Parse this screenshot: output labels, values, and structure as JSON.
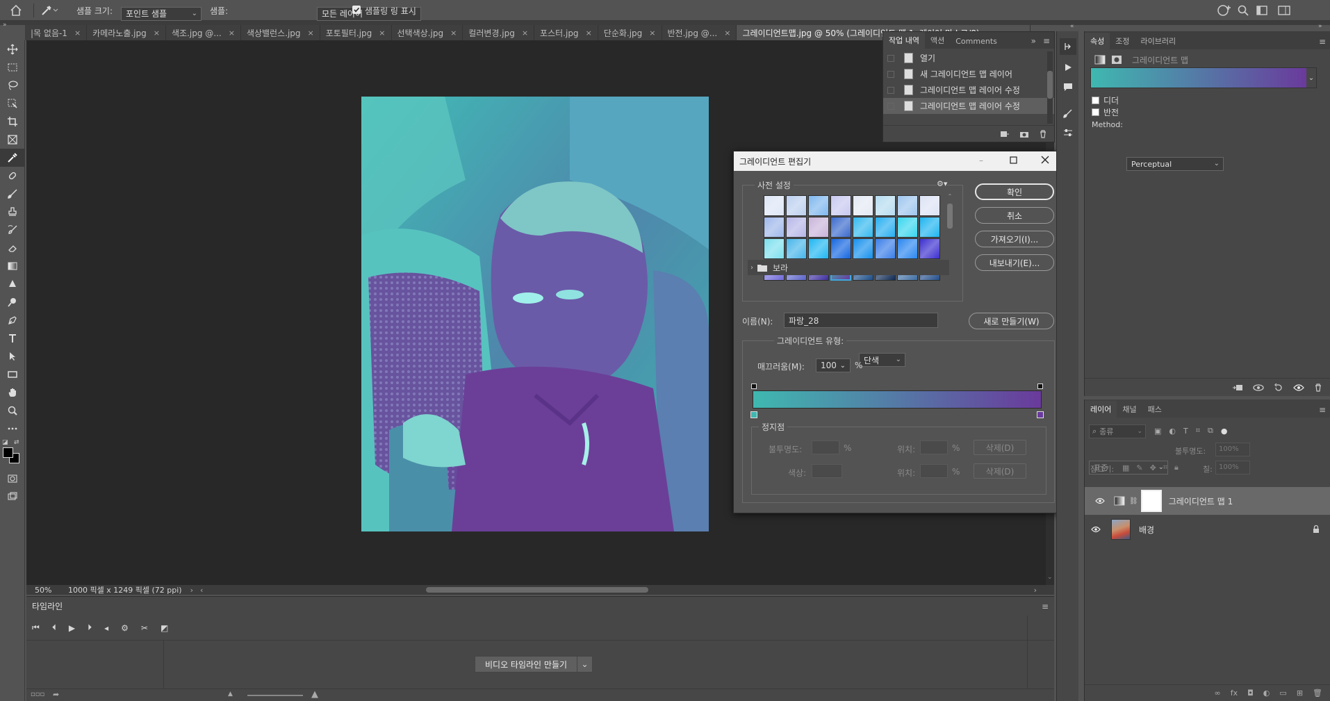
{
  "options_bar": {
    "sample_size_label": "샘플 크기:",
    "sample_size_value": "포인트 샘플",
    "sample_label": "샘플:",
    "sample_value": "모든 레이어",
    "show_ring_label": "샘플링 링 표시",
    "show_ring_checked": true
  },
  "tabs": [
    {
      "label": "|목 없음-1",
      "active": false
    },
    {
      "label": "카메라노출.jpg",
      "active": false
    },
    {
      "label": "색조.jpg @...",
      "active": false
    },
    {
      "label": "색상밸런스.jpg",
      "active": false
    },
    {
      "label": "포토필터.jpg",
      "active": false
    },
    {
      "label": "선택색상.jpg",
      "active": false
    },
    {
      "label": "컬러변경.jpg",
      "active": false
    },
    {
      "label": "포스터.jpg",
      "active": false
    },
    {
      "label": "단순화.jpg",
      "active": false
    },
    {
      "label": "반전.jpg @...",
      "active": false
    },
    {
      "label": "그레이디언트맵.jpg @ 50% (그레이디언트 맵 1, 레이어 마스크/8)",
      "active": true
    }
  ],
  "status_bar": {
    "zoom": "50%",
    "doc_info": "1000 픽셀 x 1249 픽셀 (72 ppi)"
  },
  "timeline": {
    "title": "타임라인",
    "create_button": "비디오 타임라인 만들기"
  },
  "history_panel": {
    "tabs": [
      "작업 내역",
      "액션",
      "Comments"
    ],
    "items": [
      {
        "label": "열기",
        "selected": false
      },
      {
        "label": "새 그레이디언트 맵 레이어",
        "selected": false
      },
      {
        "label": "그레이디언트 맵 레이어 수정",
        "selected": false
      },
      {
        "label": "그레이디언트 맵 레이어 수정",
        "selected": true
      }
    ]
  },
  "gradient_editor": {
    "title": "그레이디언트 편집기",
    "presets_label": "사전 설정",
    "folder_label": "보라",
    "ok_button": "확인",
    "cancel_button": "취소",
    "import_button": "가져오기(I)...",
    "export_button": "내보내기(E)...",
    "name_label": "이름(N):",
    "name_value": "파랑_28",
    "new_button": "새로 만들기(W)",
    "type_label": "그레이디언트 유형:",
    "type_value": "단색",
    "smoothness_label": "매끄러움(M):",
    "smoothness_value": "100",
    "smoothness_unit": "%",
    "stops_label": "정지점",
    "opacity_label": "불투명도:",
    "location_label": "위치:",
    "color_label": "색상:",
    "delete_label": "삭제(D)",
    "percent": "%",
    "gradient_start_color": "#3fb8b0",
    "gradient_end_color": "#6a3a9c",
    "presets": [
      [
        "#dde6f6",
        "#bcd0ef",
        "#7fb7ee",
        "#c8c8f0",
        "#e4e9f3",
        "#b6dcf0",
        "#9ec6ee",
        "#dde3f5"
      ],
      [
        "#9fb7ea",
        "#b6b6e8",
        "#c9b4da",
        "#3a6acc",
        "#34b8ee",
        "#26aef0",
        "#38d6ee",
        "#1eb4f0"
      ],
      [
        "#7ce0ee",
        "#47b5ea",
        "#1fb6f2",
        "#1466e0",
        "#1590ec",
        "#3a7ee8",
        "#2a86f0",
        "#3c2fcf"
      ],
      [
        "#6f68d8",
        "#5b63c8",
        "#3d2e9e",
        "#3fa3b0",
        "#1c4e88",
        "#102a54",
        "#3f6ea2",
        "#244e8a"
      ]
    ],
    "selected_preset_row": 3,
    "selected_preset_col": 3
  },
  "properties_panel": {
    "tabs": [
      "속성",
      "조정",
      "라이브러리"
    ],
    "title": "그레이디언트 맵",
    "dither_label": "디더",
    "reverse_label": "반전",
    "method_label": "Method:",
    "method_value": "Perceptual"
  },
  "layers_panel": {
    "tabs": [
      "레이어",
      "채널",
      "패스"
    ],
    "filter_placeholder": "종류",
    "blend_mode": "표준",
    "opacity_label": "불투명도:",
    "opacity_value": "100%",
    "lock_label": "잠그기:",
    "fill_label": "칠:",
    "fill_value": "100%",
    "layers": [
      {
        "name": "그레이디언트 맵 1",
        "selected": true
      },
      {
        "name": "배경",
        "selected": false
      }
    ]
  }
}
